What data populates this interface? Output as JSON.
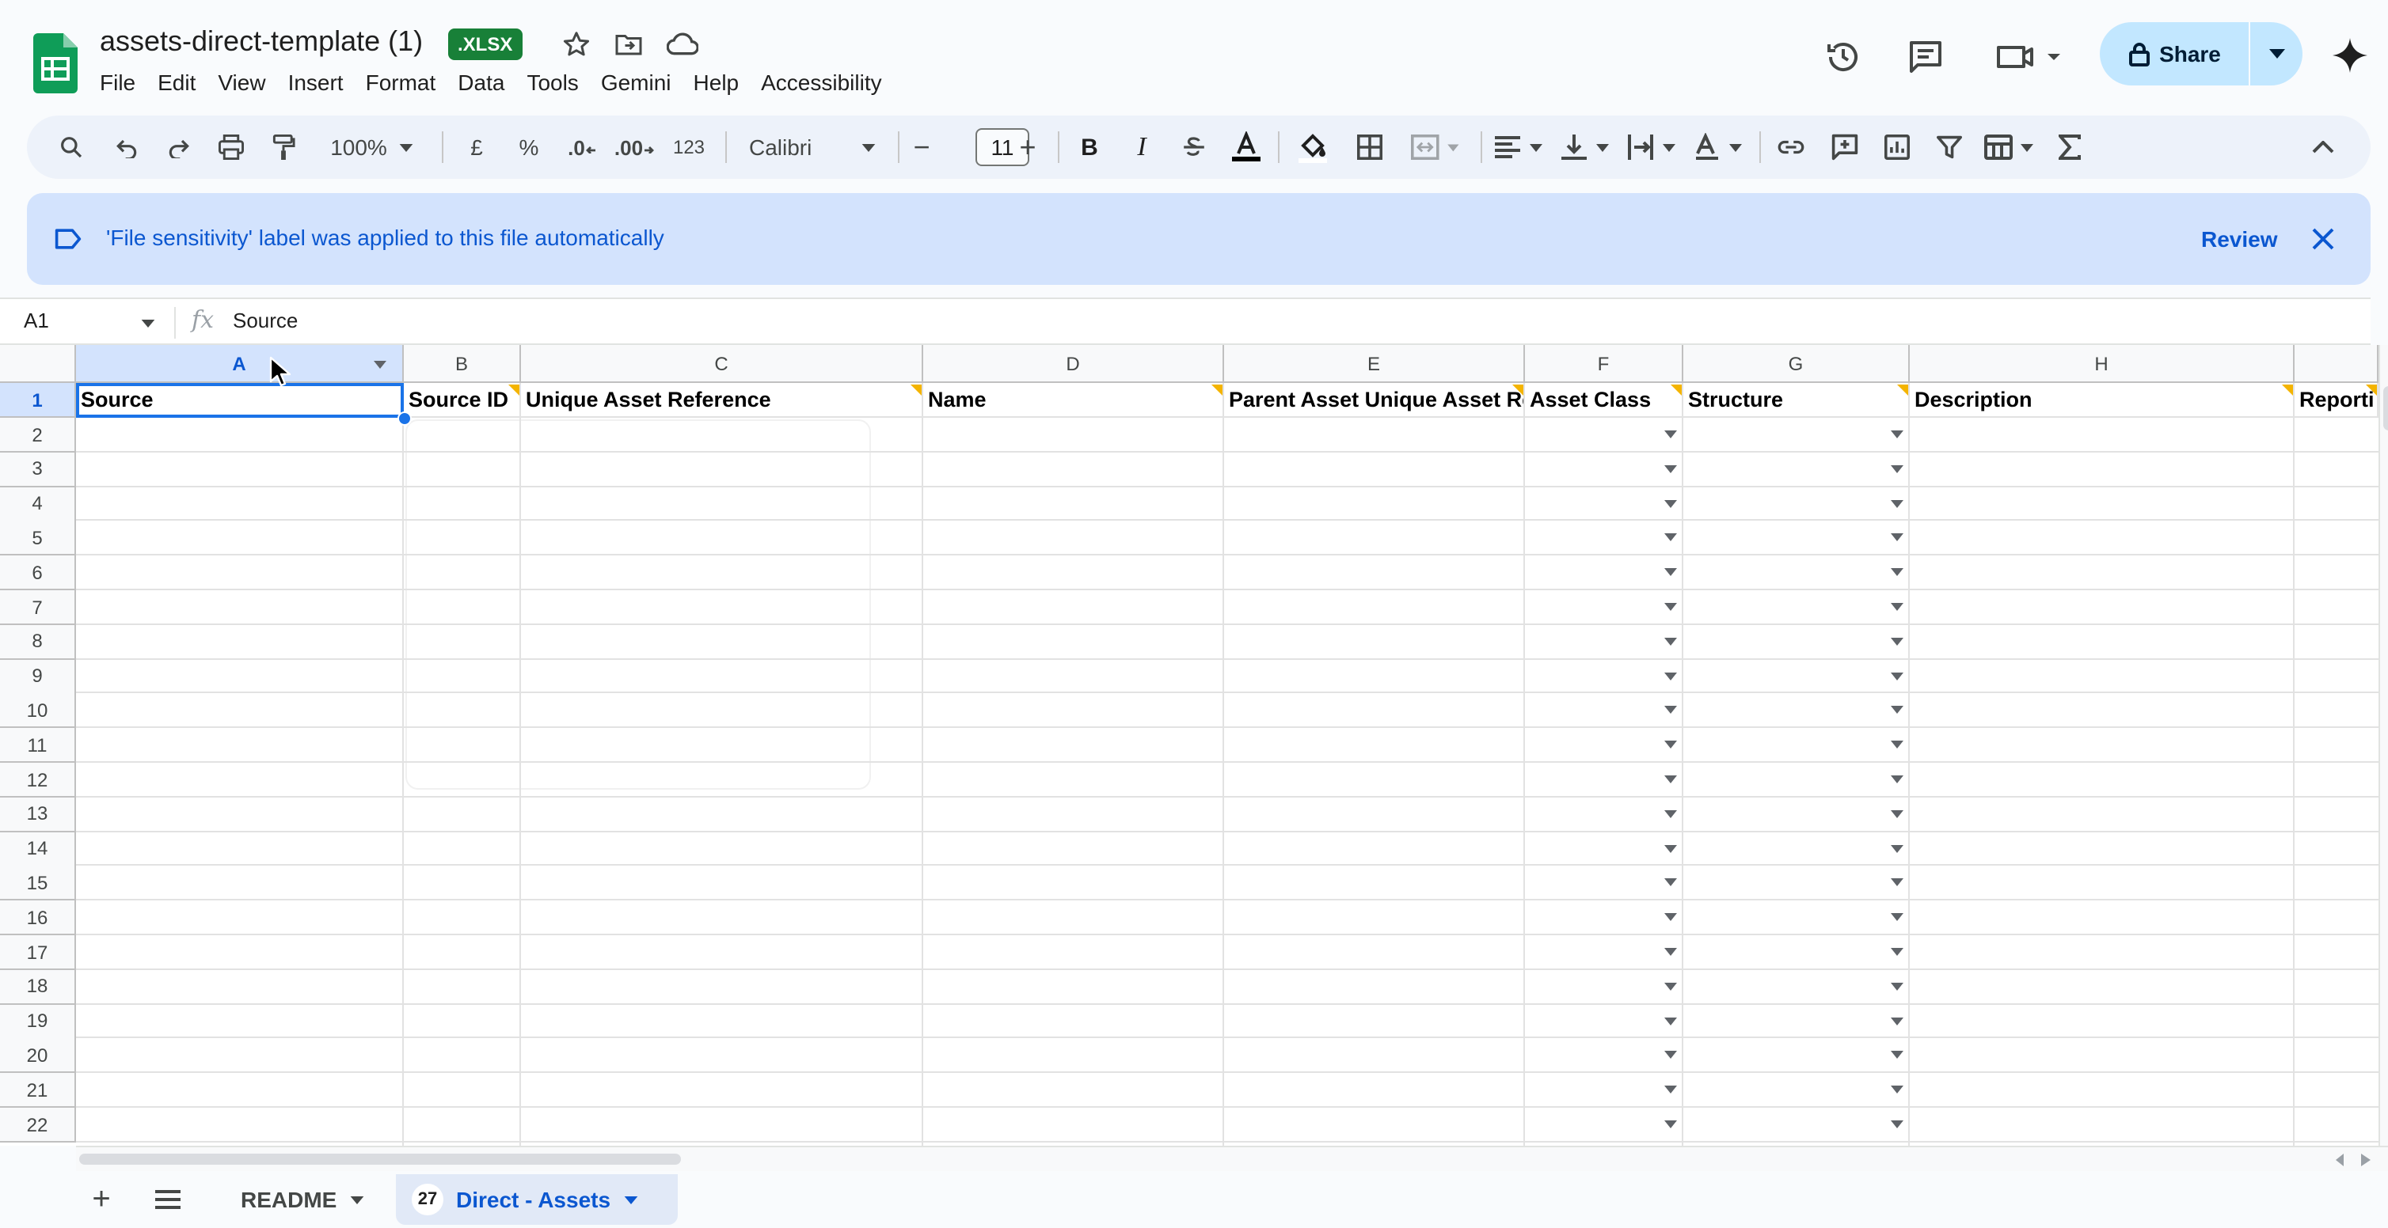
{
  "app": {
    "doc_title": "assets-direct-template (1)",
    "file_badge": ".XLSX",
    "menu": [
      "File",
      "Edit",
      "View",
      "Insert",
      "Format",
      "Data",
      "Tools",
      "Gemini",
      "Help",
      "Accessibility"
    ],
    "share_label": "Share"
  },
  "toolbar": {
    "zoom": "100%",
    "currency": "£",
    "percent": "%",
    "dec_decrease": ".0",
    "dec_increase": ".00",
    "number_format": "123",
    "font": "Calibri",
    "font_size": "11",
    "minus": "−",
    "plus": "+",
    "bold": "B",
    "italic": "I"
  },
  "banner": {
    "text": "'File sensitivity' label was applied to this file automatically",
    "review_label": "Review"
  },
  "formula_bar": {
    "cell_ref": "A1",
    "fx": "fx",
    "value": "Source"
  },
  "grid": {
    "columns": [
      "A",
      "B",
      "C",
      "D",
      "E",
      "F",
      "G",
      "H",
      ""
    ],
    "header_row": [
      "Source",
      "Source ID",
      "Unique Asset Reference",
      "Name",
      "Parent Asset Unique Asset Ref",
      "Asset Class",
      "Structure",
      "Description",
      "Reporti"
    ],
    "row_numbers": [
      "1",
      "2",
      "3",
      "4",
      "5",
      "6",
      "7",
      "8",
      "9",
      "10",
      "11",
      "12",
      "13",
      "14",
      "15",
      "16",
      "17",
      "18",
      "19",
      "20",
      "21",
      "22"
    ]
  },
  "sheets": {
    "add": "+",
    "tabs": [
      {
        "label": "README"
      },
      {
        "label": "Direct - Assets",
        "badge": "27"
      }
    ]
  },
  "colors": {
    "accent": "#0b57d0",
    "share_bg": "#c2e7ff",
    "banner_bg": "#d3e3fd",
    "xlsx_badge": "#188038",
    "note_marker": "#f4b400"
  }
}
